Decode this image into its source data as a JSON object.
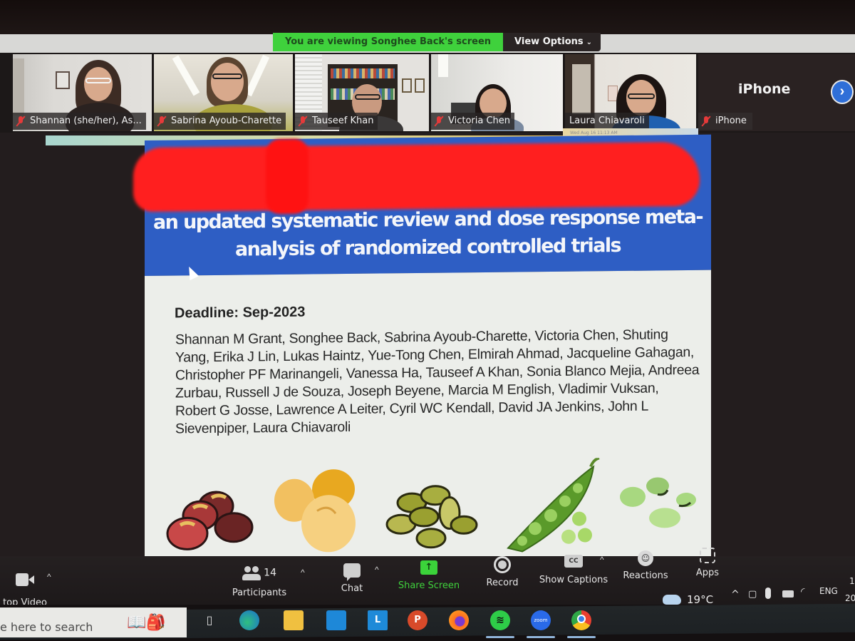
{
  "banner": {
    "viewing_text": "You are viewing Songhee Back's screen",
    "view_options_label": "View Options",
    "view_options_icon": "chevron-down-icon",
    "banner_color": "#3fd13c"
  },
  "participants": [
    {
      "name": "Shannan (she/her), As...",
      "muted": true
    },
    {
      "name": "Sabrina Ayoub-Charette",
      "muted": true
    },
    {
      "name": "Tauseef Khan",
      "muted": true
    },
    {
      "name": "Victoria Chen",
      "muted": true
    },
    {
      "name": "Laura Chiavaroli",
      "muted": false,
      "active_speaker": true
    },
    {
      "name": "iPhone",
      "label": "iPhone",
      "muted": true,
      "video_off": true
    }
  ],
  "gallery_next_icon": "chevron-right-icon",
  "host_status": {
    "clock_text": "Wed Aug 16 11:13 AM"
  },
  "slide": {
    "header_color": "#2e5ec4",
    "title_redacted": true,
    "title_lines": [
      "an updated systematic review and dose response meta-",
      "analysis of randomized controlled trials"
    ],
    "deadline": "Deadline: Sep-2023",
    "authors": "Shannan M Grant, Songhee Back, Sabrina Ayoub-Charette, Victoria Chen, Shuting Yang, Erika J Lin, Lukas Haintz, Yue-Tong Chen, Elmirah Ahmad, Jacqueline Gahagan, Christopher PF Marinangeli, Vanessa Ha, Tauseef A Khan, Sonia Blanco Mejia, Andreea Zurbau, Russell J de Souza, Joseph Beyene, Marcia M English, Vladimir Vuksan, Robert G Josse, Lawrence A Leiter, Cyril WC Kendall, David JA Jenkins, John L Sievenpiper, Laura Chiavaroli",
    "illustrations": [
      "kidney-beans",
      "chickpeas",
      "lentils",
      "pea-pod",
      "fava-beans"
    ]
  },
  "toolbar": {
    "video_label": "top Video",
    "participants_label": "Participants",
    "participants_count": "14",
    "chat_label": "Chat",
    "share_label": "Share Screen",
    "share_arrow": "↑",
    "record_label": "Record",
    "captions_label": "Show Captions",
    "cc_text": "CC",
    "reactions_label": "Reactions",
    "apps_label": "Apps",
    "caret": "^",
    "share_color": "#3bd33a"
  },
  "taskbar": {
    "search_placeholder": "e here to search",
    "apps": [
      "task-view",
      "edge",
      "file-explorer",
      "mail",
      "l-app",
      "powerpoint",
      "firefox",
      "spotify",
      "zoom",
      "chrome"
    ],
    "zoom_label": "zoom",
    "l_label": "L",
    "p_label": "P",
    "weather_temp": "19°C",
    "tray_caret": "^",
    "language": "ENG",
    "clock_partial_top": "1",
    "clock_partial_bottom": "20"
  }
}
